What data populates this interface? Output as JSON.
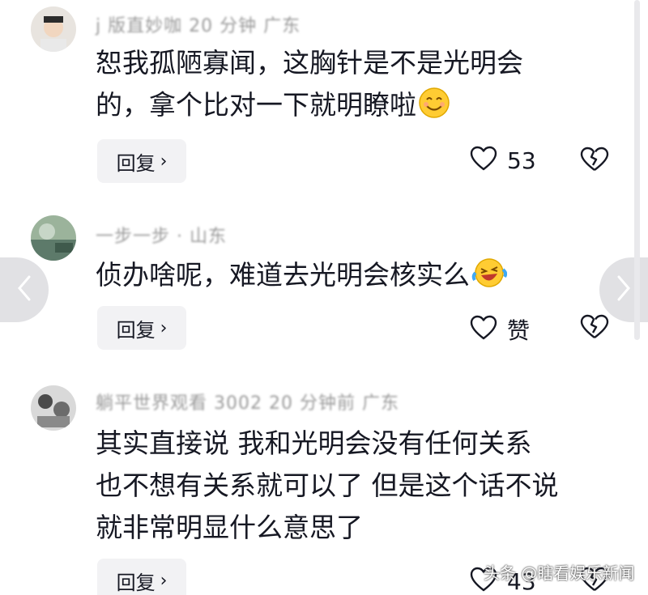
{
  "comments": [
    {
      "meta": "j 版直妙咖 20 分钟 广东",
      "line1": "恕我孤陋寡闻，这胸针是不是光明会",
      "line2": "的，拿个比对一下就明瞭啦",
      "emoji": "smiling-face-emoji",
      "reply_label": "回复",
      "like_count": "53"
    },
    {
      "meta": "一步一步 · 山东",
      "line1": "侦办啥呢，难道去光明会核实么",
      "emoji": "laughing-tears-emoji",
      "reply_label": "回复",
      "like_count": "赞"
    },
    {
      "meta": "躺平世界观看 3002 20 分钟前 广东",
      "line1": "其实直接说 我和光明会没有任何关系",
      "line2": "也不想有关系就可以了 但是这个话不说",
      "line3": "就非常明显什么意思了",
      "reply_label": "回复",
      "like_count": "43"
    }
  ],
  "watermark": "头条 @瞎看娱乐新闻",
  "colors": {
    "text": "#161823",
    "meta": "#9a9a9a",
    "button_bg": "#f2f2f4"
  }
}
